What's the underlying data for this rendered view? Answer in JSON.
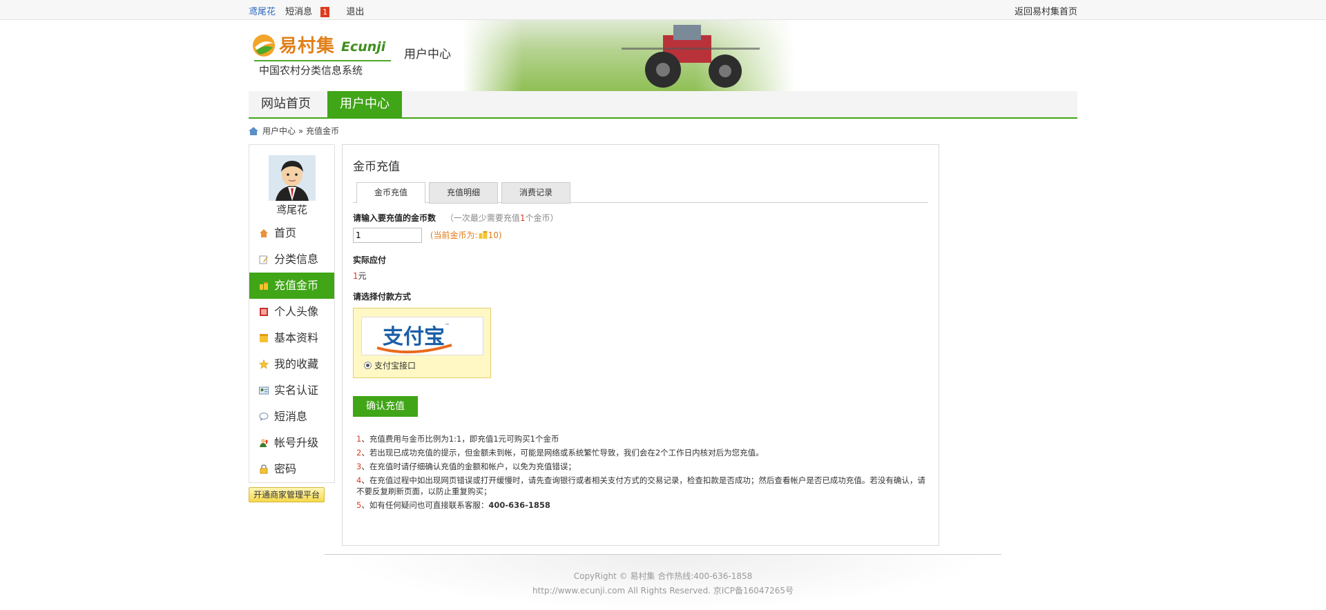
{
  "topbar": {
    "username": "鸢尾花",
    "messages_label": "短消息",
    "messages_count": "1",
    "logout": "退出",
    "back_home": "返回易村集首页"
  },
  "header": {
    "logo_cn": "易村集",
    "logo_en": "Ecunji",
    "logo_sub": "中国农村分类信息系统",
    "title": "用户中心"
  },
  "nav": {
    "home": "网站首页",
    "user_center": "用户中心"
  },
  "breadcrumb": {
    "home": "用户中心",
    "sep": " » ",
    "current": "充值金币"
  },
  "sidebar": {
    "username": "鸢尾花",
    "items": [
      {
        "label": "首页",
        "icon": "home-icon"
      },
      {
        "label": "分类信息",
        "icon": "edit-icon"
      },
      {
        "label": "充值金币",
        "icon": "coins-icon"
      },
      {
        "label": "个人头像",
        "icon": "picture-icon"
      },
      {
        "label": "基本资料",
        "icon": "note-icon"
      },
      {
        "label": "我的收藏",
        "icon": "star-icon"
      },
      {
        "label": "实名认证",
        "icon": "id-card-icon"
      },
      {
        "label": "短消息",
        "icon": "chat-icon"
      },
      {
        "label": "帐号升级",
        "icon": "user-up-icon"
      },
      {
        "label": "密码",
        "icon": "lock-icon"
      }
    ],
    "merchant_button": "开通商家管理平台"
  },
  "main": {
    "title": "金币充值",
    "tabs": [
      "金币充值",
      "充值明细",
      "消费记录"
    ],
    "amount_label": "请输入要充值的金币数",
    "amount_hint_pre": "（一次最少需要充值",
    "amount_hint_num": "1",
    "amount_hint_post": "个金币）",
    "amount_value": "1",
    "current_gold_pre": "(当前金币为:",
    "current_gold_value": "10",
    "current_gold_post": ")",
    "pay_label": "实际应付",
    "pay_amount": "1",
    "pay_unit": "元",
    "method_label": "请选择付款方式",
    "alipay_text": "支付宝",
    "alipay_option": "支付宝接口",
    "confirm": "确认充值",
    "notes": [
      {
        "num": "1",
        "text": "、充值费用与金币比例为1:1，即充值1元可购买1个金币"
      },
      {
        "num": "2",
        "text": "、若出现已成功充值的提示，但金额未到帐，可能是网络或系统繁忙导致，我们会在2个工作日内核对后为您充值。"
      },
      {
        "num": "3",
        "text": "、在充值时请仔细确认充值的金额和帐户，以免为充值错误；"
      },
      {
        "num": "4",
        "text": "、在充值过程中如出现网页错误或打开缓慢时，请先查询银行或者相关支付方式的交易记录，检查扣款是否成功；然后查看帐户是否已成功充值。若没有确认，请不要反复刷新页面，以防止重复购买；"
      },
      {
        "num": "5",
        "text": "、如有任何疑问也可直接联系客服：",
        "tel": "400-636-1858"
      }
    ]
  },
  "footer": {
    "line1": "CopyRight © 易村集 合作热线:400-636-1858",
    "line2": "http://www.ecunji.com All Rights Reserved. 京ICP备16047265号"
  },
  "colors": {
    "brand_green": "#40a517",
    "accent_red": "#e03a1e",
    "gold_orange": "#e07a1a"
  }
}
